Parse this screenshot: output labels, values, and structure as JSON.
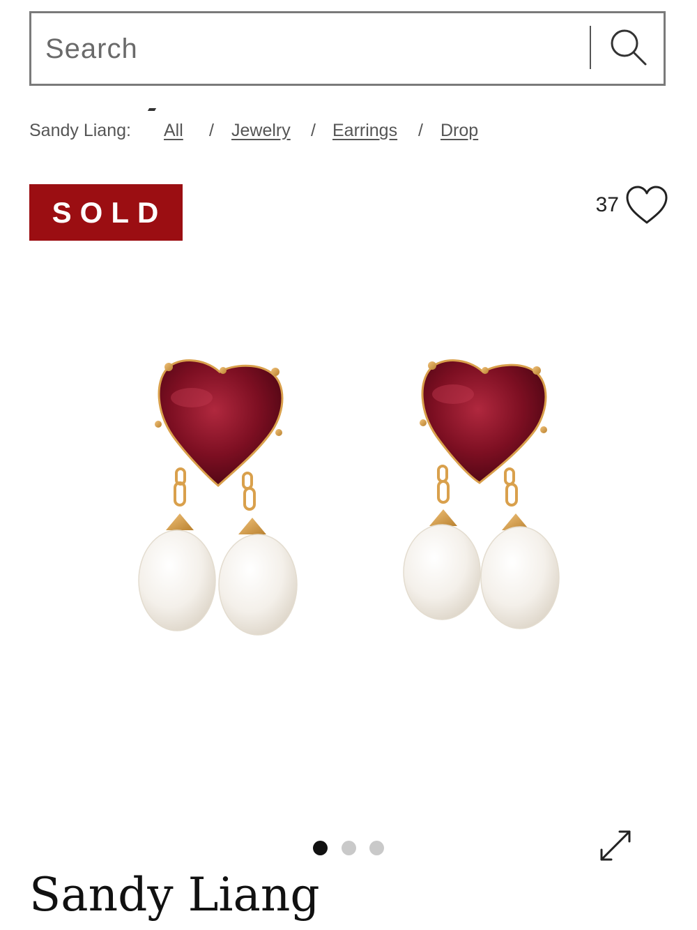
{
  "search": {
    "placeholder": "Search",
    "value": "",
    "icon": "search-icon"
  },
  "breadcrumb": {
    "prefix": "Sandy Liang:",
    "separator": "/",
    "items": [
      {
        "label": "All"
      },
      {
        "label": "Jewelry"
      },
      {
        "label": "Earrings"
      },
      {
        "label": "Drop"
      }
    ]
  },
  "badge": {
    "label": "SOLD",
    "color": "#9b0e12"
  },
  "favorites": {
    "count": "37",
    "icon": "heart-outline-icon"
  },
  "gallery": {
    "dot_count": 3,
    "active_index": 0,
    "expand_icon": "expand-arrows-icon"
  },
  "product": {
    "brand": "Sandy Liang"
  },
  "colors": {
    "sold_red": "#9b0e12",
    "stone_red": "#7d0f22",
    "gold": "#d9a04c",
    "pearl": "#f4f0ea"
  }
}
